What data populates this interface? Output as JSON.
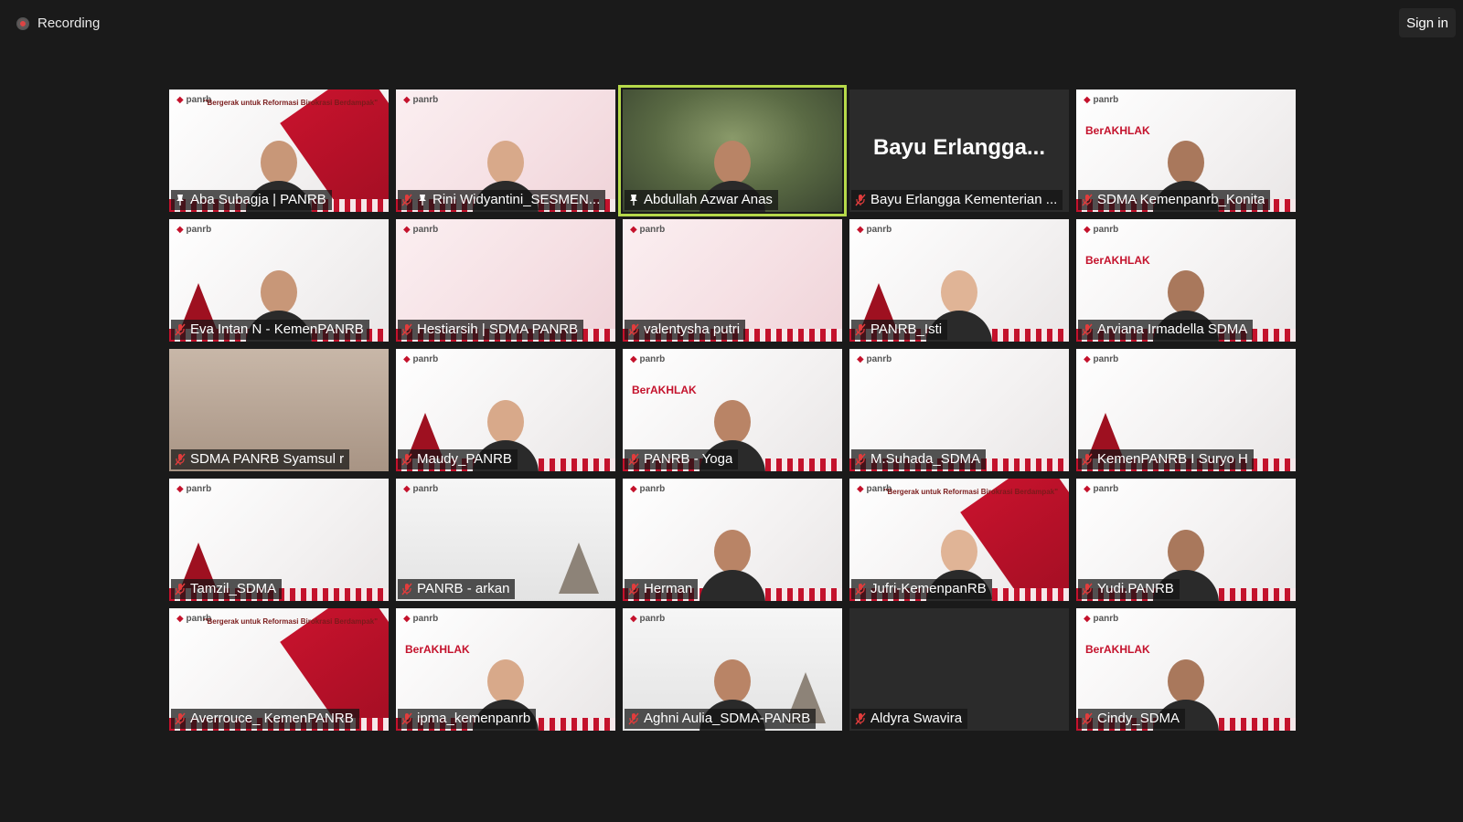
{
  "recording": {
    "label": "Recording"
  },
  "signin": {
    "label": "Sign in"
  },
  "slogan": "\"Bergerak untuk Reformasi Birokrasi Berdampak\"",
  "brand": "BerAKHLAK",
  "logo_text": "panrb",
  "participants": [
    {
      "name": "Aba Subagja | PANRB",
      "pinned": true,
      "muted": false,
      "bg": "white",
      "band": true,
      "person": true
    },
    {
      "name": "Rini Widyantini_SESMEN...",
      "pinned": true,
      "muted": true,
      "bg": "pink",
      "person": true
    },
    {
      "name": "Abdullah Azwar Anas",
      "pinned": true,
      "muted": false,
      "bg": "photo",
      "active": true,
      "person": true
    },
    {
      "name": "Bayu Erlangga Kementerian ...",
      "pinned": false,
      "muted": true,
      "bg": "dark",
      "big_name": "Bayu  Erlangga..."
    },
    {
      "name": "SDMA Kemenpanrb_Konita",
      "pinned": false,
      "muted": true,
      "bg": "white",
      "brand": true,
      "person": true
    },
    {
      "name": "Eva Intan N - KemenPANRB",
      "muted": true,
      "bg": "white",
      "temple": true,
      "person": true
    },
    {
      "name": "Hestiarsih | SDMA PANRB",
      "muted": true,
      "bg": "pink"
    },
    {
      "name": "valentysha putri",
      "muted": true,
      "bg": "pink"
    },
    {
      "name": "PANRB_Isti",
      "muted": true,
      "bg": "white",
      "temple": true,
      "person": true
    },
    {
      "name": "Arviana Irmadella SDMA",
      "muted": true,
      "bg": "white",
      "brand": true,
      "person": true
    },
    {
      "name": "SDMA PANRB Syamsul r",
      "muted": true,
      "bg": "beige"
    },
    {
      "name": "Maudy_PANRB",
      "muted": true,
      "bg": "white",
      "temple": true,
      "person": true
    },
    {
      "name": "PANRB - Yoga",
      "muted": true,
      "bg": "white",
      "brand": true,
      "person": true
    },
    {
      "name": "M.Suhada_SDMA",
      "muted": true,
      "bg": "white"
    },
    {
      "name": "KemenPANRB I Suryo H",
      "muted": true,
      "bg": "white",
      "temple": true
    },
    {
      "name": "Tamzil_SDMA",
      "muted": true,
      "bg": "white",
      "temple": true
    },
    {
      "name": "PANRB - arkan",
      "muted": true,
      "bg": "gray",
      "temple_gray": true
    },
    {
      "name": "Herman",
      "muted": true,
      "bg": "white",
      "person": true
    },
    {
      "name": "Jufri-KemenpanRB",
      "muted": true,
      "bg": "white",
      "band": true,
      "person": true
    },
    {
      "name": "Yudi.PANRB",
      "muted": true,
      "bg": "white",
      "person": true
    },
    {
      "name": "Averrouce_ KemenPANRB",
      "muted": true,
      "bg": "white",
      "band": true
    },
    {
      "name": "ipma_kemenpanrb",
      "muted": true,
      "bg": "white",
      "brand": true,
      "person": true
    },
    {
      "name": "Aghni Aulia_SDMA-PANRB",
      "muted": true,
      "bg": "gray",
      "temple_gray": true,
      "person": true
    },
    {
      "name": "Aldyra Swavira",
      "muted": true,
      "bg": "dark"
    },
    {
      "name": "Cindy_SDMA",
      "muted": true,
      "bg": "white",
      "brand": true,
      "person": true
    }
  ]
}
